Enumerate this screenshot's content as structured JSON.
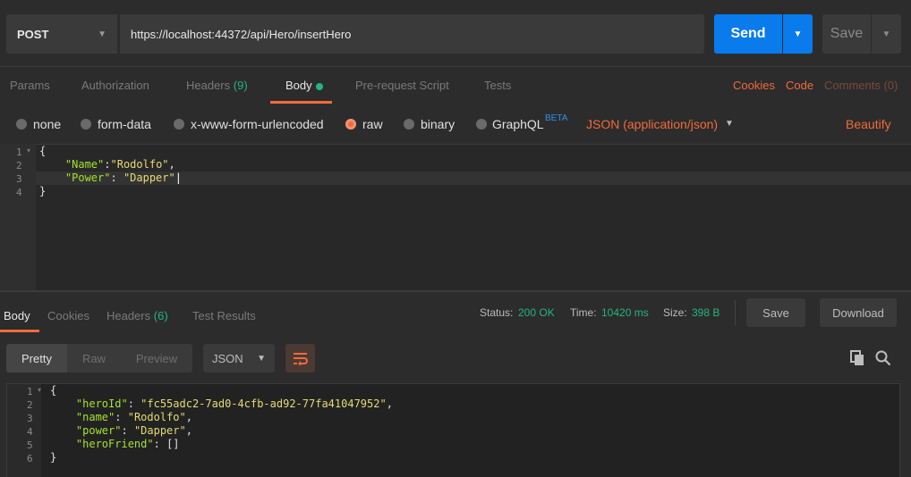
{
  "request": {
    "method": "POST",
    "url": "https://localhost:44372/api/Hero/insertHero",
    "send_label": "Send",
    "save_label": "Save"
  },
  "request_tabs": {
    "params": "Params",
    "authorization": "Authorization",
    "headers": "Headers",
    "headers_count": "(9)",
    "body": "Body",
    "pre_request": "Pre-request Script",
    "tests": "Tests",
    "cookies": "Cookies",
    "code": "Code",
    "comments": "Comments (0)"
  },
  "body_types": {
    "none": "none",
    "form_data": "form-data",
    "urlencoded": "x-www-form-urlencoded",
    "raw": "raw",
    "binary": "binary",
    "graphql": "GraphQL",
    "beta": "BETA",
    "content_type": "JSON (application/json)",
    "beautify": "Beautify",
    "selected": "raw"
  },
  "request_body": {
    "line_numbers": [
      "1",
      "2",
      "3",
      "4"
    ],
    "l1": "{",
    "l2_key": "\"Name\"",
    "l2_rest": ":",
    "l2_val": "\"Rodolfo\"",
    "l2_end": ",",
    "l3_key": "\"Power\"",
    "l3_rest": ": ",
    "l3_val": "\"Dapper\"",
    "l4": "}"
  },
  "response_tabs": {
    "body": "Body",
    "cookies": "Cookies",
    "headers": "Headers",
    "headers_count": "(6)",
    "test_results": "Test Results"
  },
  "status": {
    "status_label": "Status:",
    "status_value": "200 OK",
    "time_label": "Time:",
    "time_value": "10420 ms",
    "size_label": "Size:",
    "size_value": "398 B",
    "save_label": "Save",
    "download_label": "Download"
  },
  "response_view": {
    "pretty": "Pretty",
    "raw": "Raw",
    "preview": "Preview",
    "format": "JSON"
  },
  "response_body": {
    "line_numbers": [
      "1",
      "2",
      "3",
      "4",
      "5",
      "6"
    ],
    "l1": "{",
    "l2_key": "\"heroId\"",
    "l2_val": "\"fc55adc2-7ad0-4cfb-ad92-77fa41047952\"",
    "l3_key": "\"name\"",
    "l3_val": "\"Rodolfo\"",
    "l4_key": "\"power\"",
    "l4_val": "\"Dapper\"",
    "l5_key": "\"heroFriend\"",
    "l5_val": "[]",
    "l6": "}"
  },
  "colors": {
    "accent": "#f26b3a",
    "send": "#097bed",
    "status_green": "#26b47f"
  },
  "icons": [
    "chevron-down-icon",
    "copy-icon",
    "search-icon",
    "wrap-lines-icon"
  ]
}
